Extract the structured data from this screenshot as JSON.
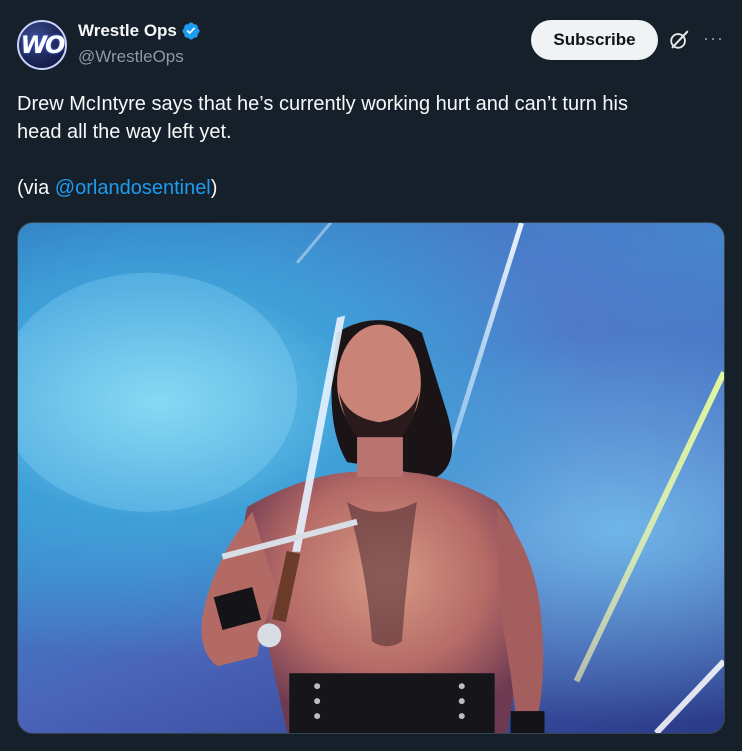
{
  "account": {
    "avatar_text": "WO",
    "display_name": "Wrestle Ops",
    "handle": "@WrestleOps",
    "verified": true
  },
  "actions": {
    "subscribe_label": "Subscribe",
    "grok_icon": "grok-icon",
    "more_icon": "more-icon",
    "more_glyph": "···"
  },
  "tweet": {
    "line1": "Drew McIntyre says that he’s currently working hurt and can’t turn his",
    "line2": "head all the way left yet.",
    "via_prefix": "(via ",
    "mention": "@orlandosentinel",
    "via_suffix": ")"
  },
  "media": {
    "description_icon": "photo",
    "colors": {
      "accent": "#1d9bf0",
      "background": "#15202b"
    }
  }
}
